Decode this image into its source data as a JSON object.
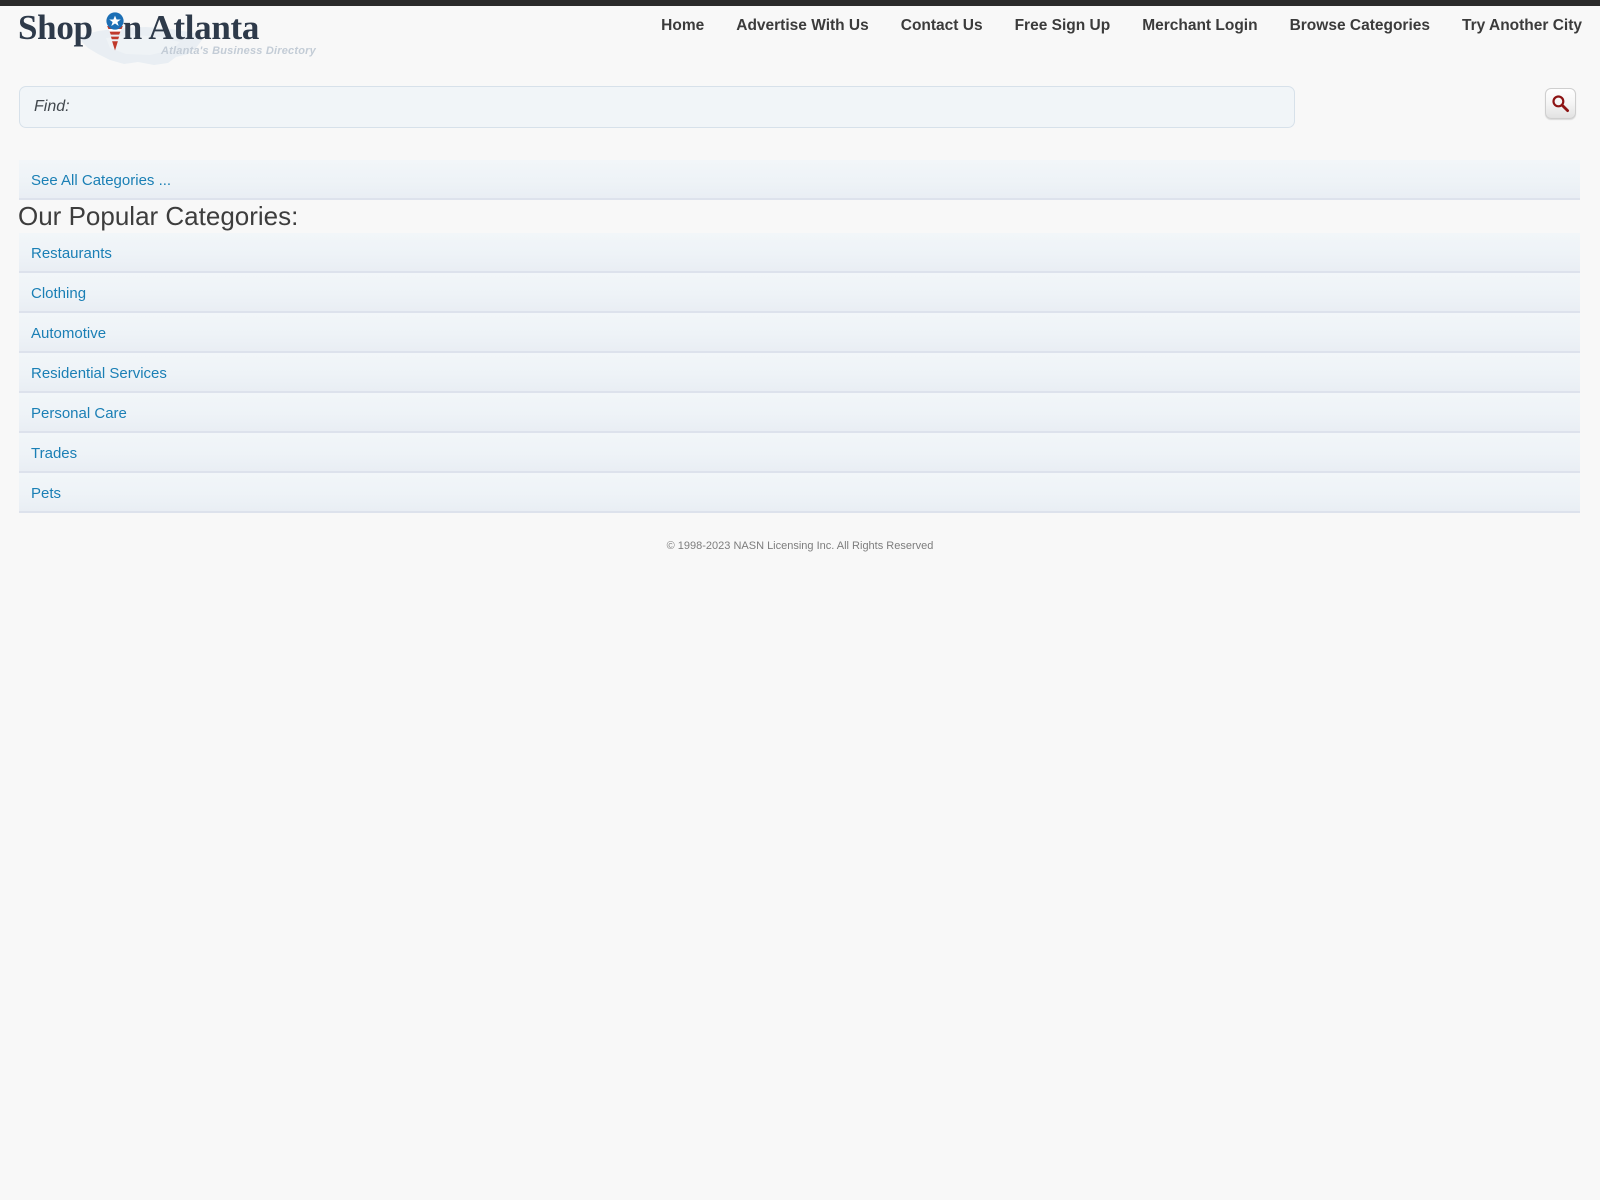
{
  "site": {
    "logo_text_before": "Shop",
    "logo_text_after": "n Atlanta",
    "tagline": "Atlanta's Business Directory",
    "pin_icon": "map-pin-icon",
    "map_icon": "us-map-icon"
  },
  "nav": {
    "items": [
      {
        "label": "Home"
      },
      {
        "label": "Advertise With Us"
      },
      {
        "label": "Contact Us"
      },
      {
        "label": "Free Sign Up"
      },
      {
        "label": "Merchant Login"
      },
      {
        "label": "Browse Categories"
      },
      {
        "label": "Try Another City"
      }
    ]
  },
  "search": {
    "placeholder": "Find:",
    "value": "",
    "button_icon": "search-icon"
  },
  "content": {
    "see_all_label": "See All Categories ...",
    "section_title": "Our Popular Categories:",
    "categories": [
      {
        "label": "Restaurants"
      },
      {
        "label": "Clothing"
      },
      {
        "label": "Automotive"
      },
      {
        "label": "Residential Services"
      },
      {
        "label": "Personal Care"
      },
      {
        "label": "Trades"
      },
      {
        "label": "Pets"
      }
    ]
  },
  "footer": {
    "copyright": "© 1998-2023 NASN Licensing Inc. All Rights Reserved"
  },
  "colors": {
    "link": "#1a7fb5",
    "logo": "#2e3a4a",
    "row_bg": "#eef3f7",
    "top_strip": "#2b2b2b",
    "search_icon": "#8d1414"
  }
}
